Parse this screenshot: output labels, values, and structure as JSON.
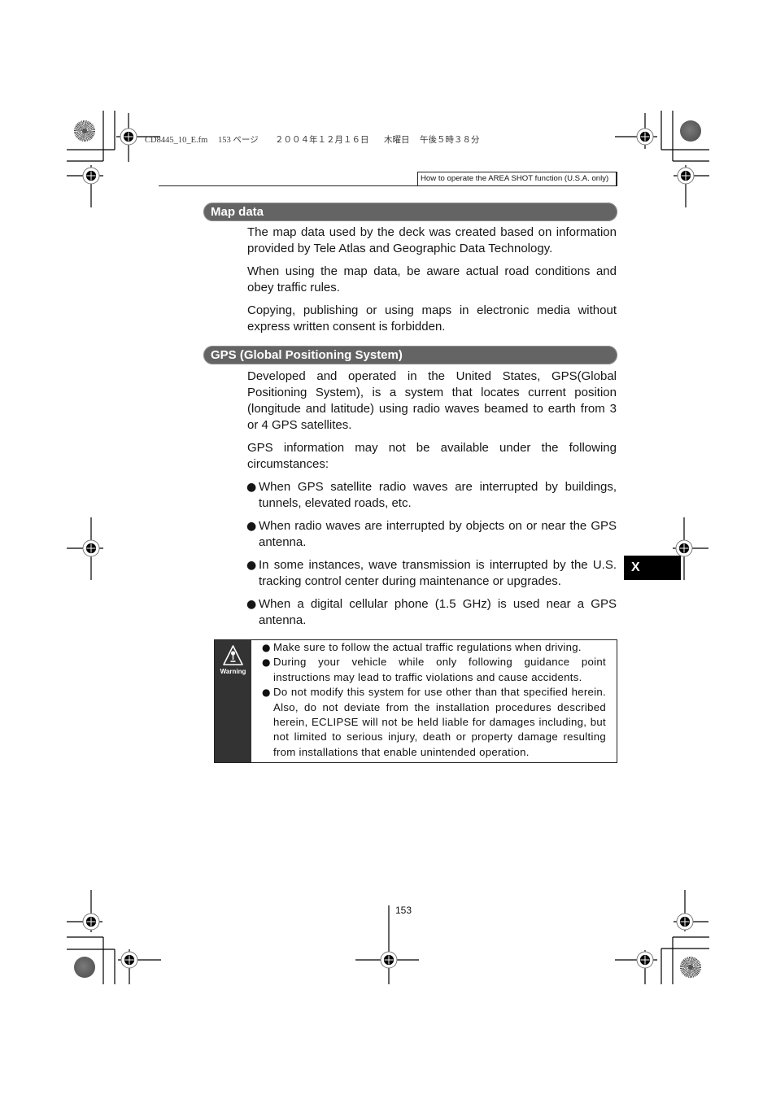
{
  "print_slug": {
    "file": "CD8445_10_E.fm",
    "page": "153 ページ",
    "date": "２００４年１２月１６日",
    "weekday": "木曜日",
    "time": "午後５時３８分"
  },
  "running_header": {
    "title": "How to operate the AREA SHOT function (U.S.A. only)"
  },
  "bullet": "●",
  "sections": [
    {
      "title": "Map data",
      "paragraphs": [
        {
          "lines": [
            "The map data used by the deck was created based on information",
            "provided by Tele Atlas and Geographic Data Technology."
          ]
        },
        {
          "lines": [
            "When using the map data, be aware actual road conditions and",
            "obey traffic rules."
          ]
        },
        {
          "lines": [
            "Copying, publishing or using maps in electronic media without",
            "express written consent is forbidden."
          ]
        }
      ]
    },
    {
      "title": "GPS (Global Positioning System)",
      "paragraphs": [
        {
          "lines": [
            "Developed and operated in the United States, GPS(Global",
            "Positioning System), is a system that locates current position",
            "(longitude and latitude) using radio waves beamed to earth from 3",
            "or 4 GPS satellites."
          ]
        },
        {
          "lines": [
            "GPS information may not be available under the following",
            "circumstances:"
          ]
        }
      ],
      "bullets": [
        {
          "lines": [
            "When GPS satellite radio waves are interrupted by buildings,",
            "tunnels, elevated roads, etc."
          ]
        },
        {
          "lines": [
            "When radio waves are interrupted by objects on or near the GPS",
            "antenna."
          ]
        },
        {
          "lines": [
            "In some instances, wave transmission is interrupted by the U.S.",
            "tracking control center during maintenance or upgrades."
          ]
        },
        {
          "lines": [
            "When a digital cellular phone (1.5 GHz) is used near a GPS",
            "antenna."
          ]
        }
      ]
    }
  ],
  "warning": {
    "icon": "warning-triangle-icon",
    "label": "Warning",
    "items": [
      {
        "lines": [
          "Make sure to follow the actual traffic regulations when driving."
        ]
      },
      {
        "lines": [
          "During your vehicle while only following guidance point",
          "instructions may lead to traffic violations and cause accidents."
        ]
      },
      {
        "lines": [
          "Do not modify this system for use other than that specified herein.",
          "Also, do not deviate from the installation procedures described",
          "herein, ECLIPSE will not be held liable for damages including, but",
          "not limited to serious injury, death or property damage resulting",
          "from installations that enable unintended operation."
        ]
      }
    ]
  },
  "chapter_tab": {
    "label": "X"
  },
  "page_number": "153",
  "colors": {
    "section_bar": "#646464",
    "warning_panel": "#333333",
    "chapter_tab": "#000000",
    "text": "#161616"
  }
}
